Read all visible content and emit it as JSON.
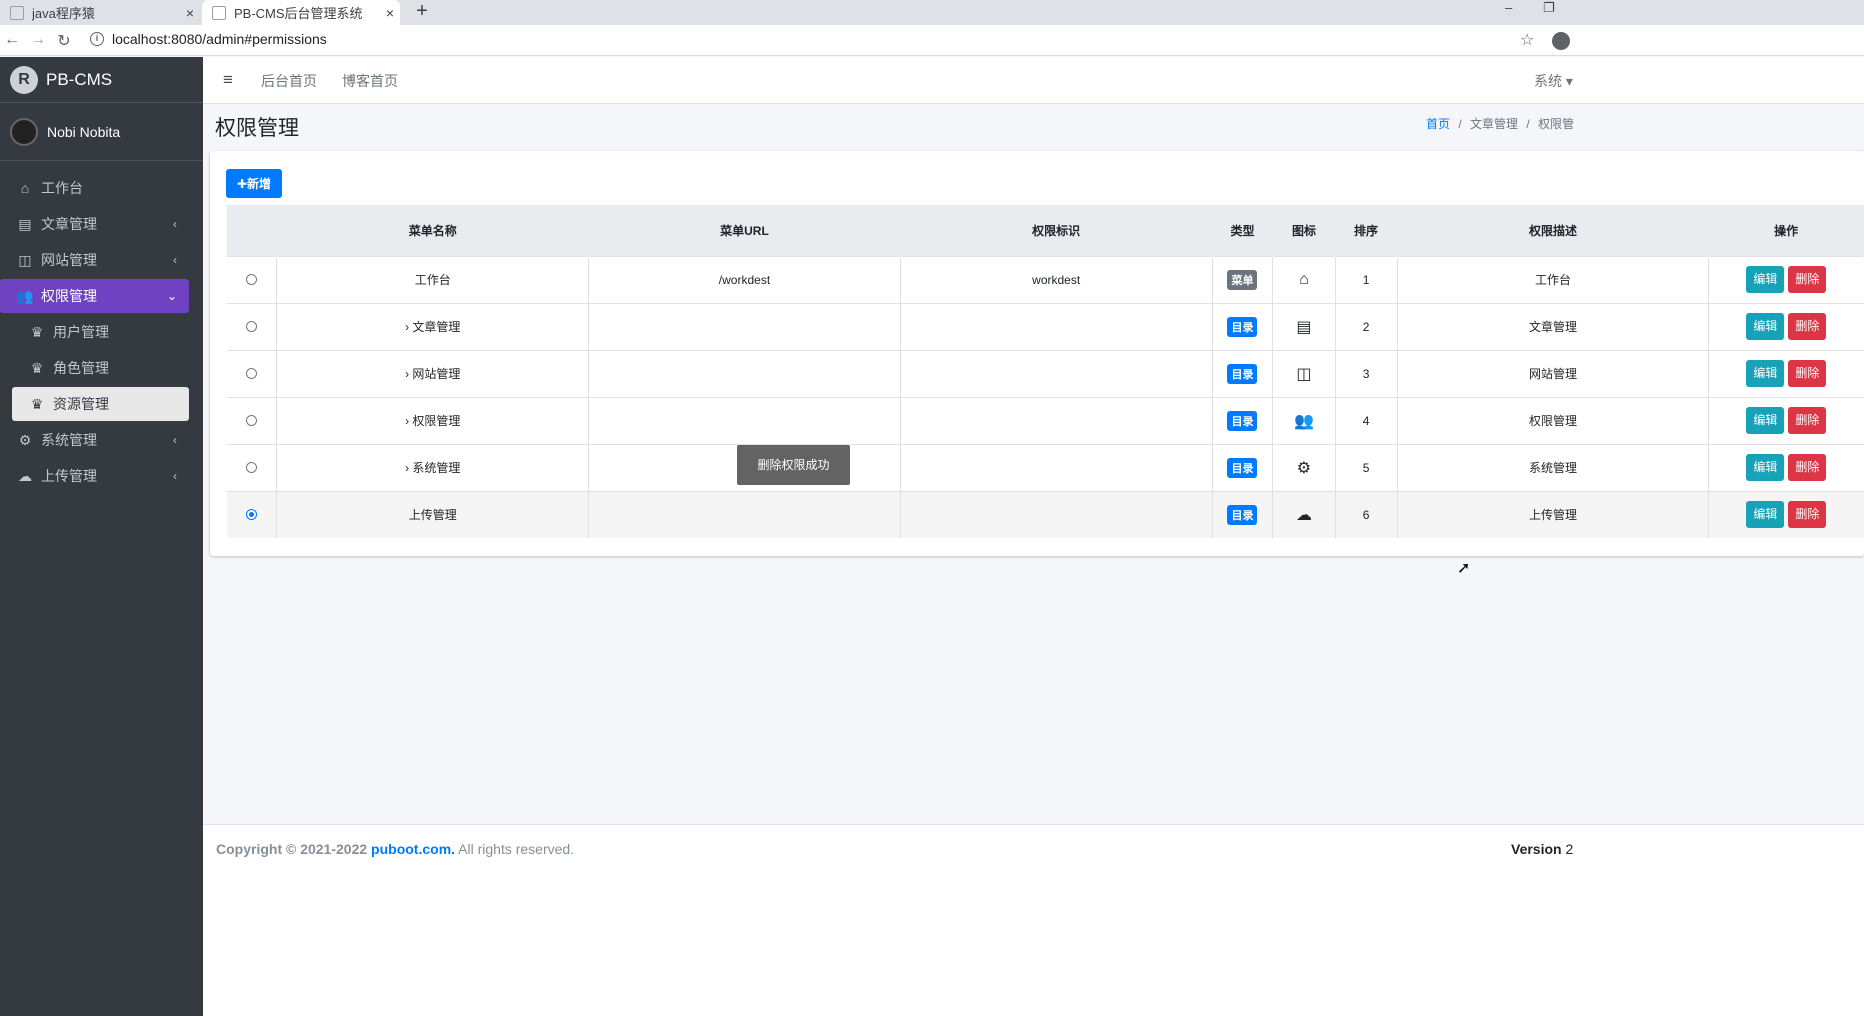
{
  "browser": {
    "tabs": [
      {
        "title": "java程序猿",
        "close": "×"
      },
      {
        "title": "PB-CMS后台管理系统",
        "close": "×"
      }
    ],
    "new_tab": "+",
    "url": "localhost:8080/admin#permissions",
    "min_icon": "–",
    "restore_icon": "❐"
  },
  "sidebar": {
    "brand": "PB-CMS",
    "brand_logo": "R",
    "user": "Nobi Nobita",
    "items": [
      {
        "label": "工作台",
        "icon": "⌂",
        "chevron": ""
      },
      {
        "label": "文章管理",
        "icon": "▤",
        "chevron": "‹"
      },
      {
        "label": "网站管理",
        "icon": "◫",
        "chevron": "‹"
      },
      {
        "label": "权限管理",
        "icon": "👥",
        "chevron": "⌄"
      },
      {
        "label": "用户管理",
        "icon": "♛",
        "chevron": ""
      },
      {
        "label": "角色管理",
        "icon": "♛",
        "chevron": ""
      },
      {
        "label": "资源管理",
        "icon": "♛",
        "chevron": ""
      },
      {
        "label": "系统管理",
        "icon": "⚙",
        "chevron": "‹"
      },
      {
        "label": "上传管理",
        "icon": "☁",
        "chevron": "‹"
      }
    ]
  },
  "topnav": {
    "hamburger": "≡",
    "links": [
      "后台首页",
      "博客首页"
    ],
    "system": "系统 ▾"
  },
  "page": {
    "title": "权限管理",
    "breadcrumb": {
      "home": "首页",
      "sep": "/",
      "level2": "文章管理",
      "level3": "权限管"
    }
  },
  "toolbar": {
    "add_label": "✚新增"
  },
  "table": {
    "headers": [
      "",
      "菜单名称",
      "菜单URL",
      "权限标识",
      "类型",
      "图标",
      "排序",
      "权限描述",
      "操作"
    ],
    "rows": [
      {
        "name": "工作台",
        "url": "/workdest",
        "perm": "workdest",
        "type": "菜单",
        "type_kind": "menu",
        "icon": "⌂",
        "order": "1",
        "desc": "工作台",
        "selected": false
      },
      {
        "name": "› 文章管理",
        "url": "",
        "perm": "",
        "type": "目录",
        "type_kind": "dir",
        "icon": "▤",
        "order": "2",
        "desc": "文章管理",
        "selected": false
      },
      {
        "name": "› 网站管理",
        "url": "",
        "perm": "",
        "type": "目录",
        "type_kind": "dir",
        "icon": "◫",
        "order": "3",
        "desc": "网站管理",
        "selected": false
      },
      {
        "name": "› 权限管理",
        "url": "",
        "perm": "",
        "type": "目录",
        "type_kind": "dir",
        "icon": "👥",
        "order": "4",
        "desc": "权限管理",
        "selected": false
      },
      {
        "name": "› 系统管理",
        "url": "",
        "perm": "",
        "type": "目录",
        "type_kind": "dir",
        "icon": "⚙",
        "order": "5",
        "desc": "系统管理",
        "selected": false
      },
      {
        "name": "上传管理",
        "url": "",
        "perm": "",
        "type": "目录",
        "type_kind": "dir",
        "icon": "☁",
        "order": "6",
        "desc": "上传管理",
        "selected": true
      }
    ],
    "edit_label": "编辑",
    "delete_label": "删除"
  },
  "toast": "删除权限成功",
  "footer": {
    "copyright": "Copyright © 2021-2022 ",
    "link": "puboot.com.",
    "rights": " All rights reserved.",
    "version_label": "Version",
    "version_value": " 2"
  }
}
